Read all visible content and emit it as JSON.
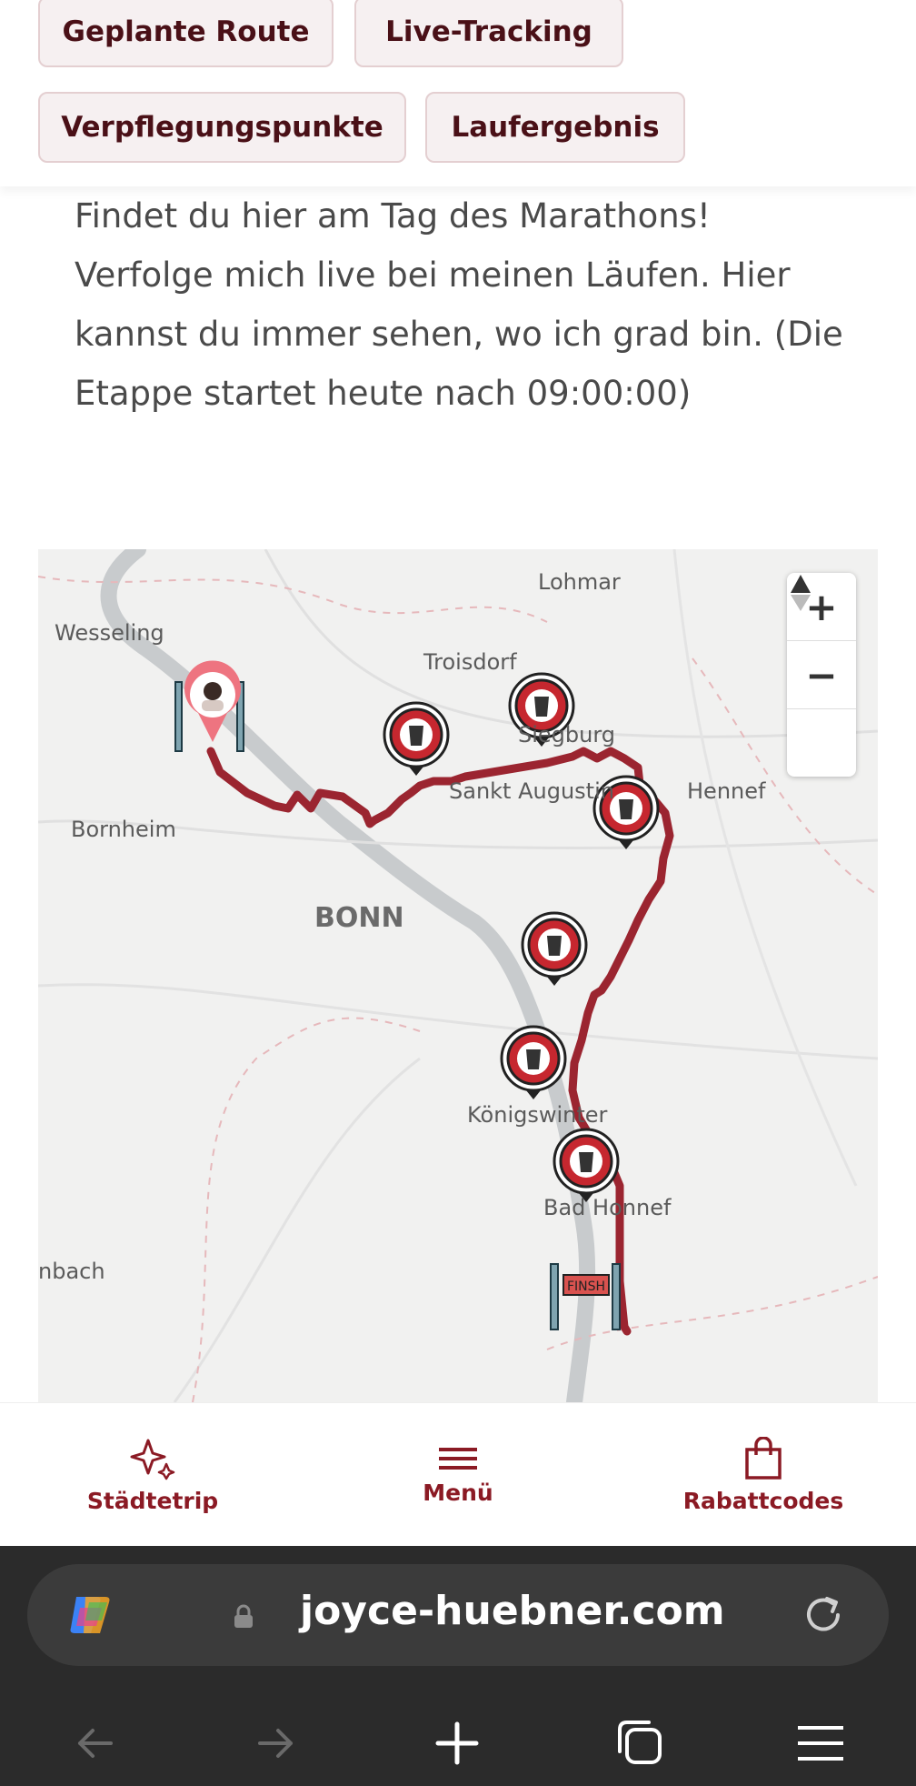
{
  "tabs": {
    "planned_route": "Geplante Route",
    "live_tracking": "Live-Tracking",
    "aid_stations": "Verpflegungspunkte",
    "runner_result": "Laufergebnis"
  },
  "intro": {
    "line1": "Findet du hier am Tag des Marathons!",
    "line2": "Verfolge mich live bei meinen Läufen. Hier kannst du immer sehen, wo ich grad bin. (Die Etappe startet heute nach 09:00:00)"
  },
  "map": {
    "labels": {
      "lohmar": "Lohmar",
      "wesseling": "Wesseling",
      "troisdorf": "Troisdorf",
      "siegburg": "Siegburg",
      "sankt_augustin": "Sankt Augustin",
      "hennef": "Hennef",
      "bornheim": "Bornheim",
      "bonn": "BONN",
      "koenigswinter": "Königswinter",
      "bad_honnef": "Bad Honnef",
      "rheinbach": "nbach"
    },
    "finish_label": "FINSH",
    "zoom_in": "+",
    "zoom_out": "−",
    "route_color": "#9b2530",
    "icons": {
      "start": "runner-avatar-pin-icon",
      "aid": "coffee-cup-pin-icon",
      "finish": "finish-gate-icon"
    }
  },
  "bottom_nav": {
    "city_trip": "Städtetrip",
    "menu": "Menü",
    "discount_codes": "Rabattcodes"
  },
  "browser": {
    "url": "joyce-huebner.com"
  }
}
